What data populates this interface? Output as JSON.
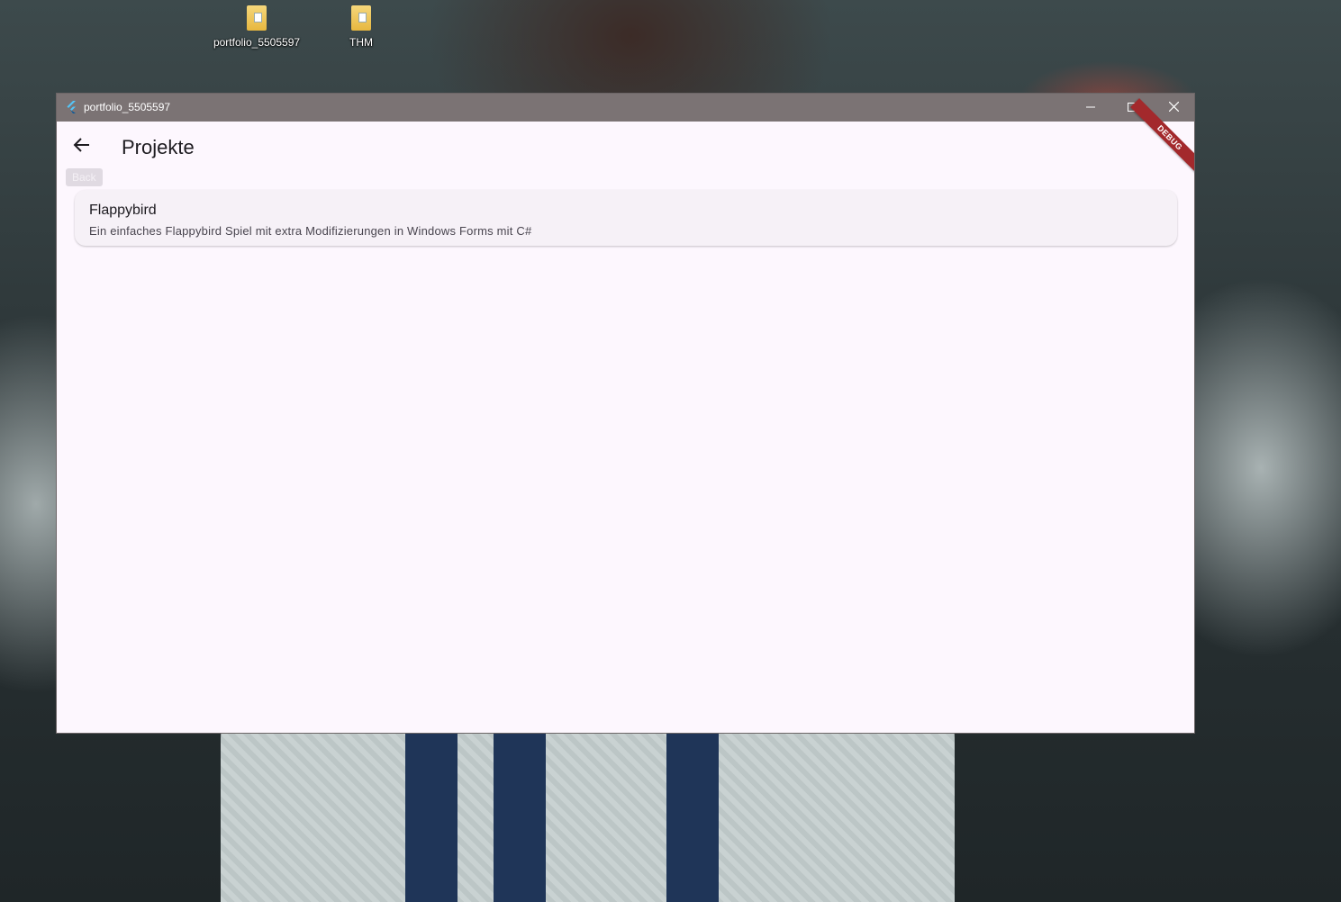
{
  "desktop": {
    "icons": [
      {
        "label": "portfolio_5505597",
        "icon": "folder-icon"
      },
      {
        "label": "THM",
        "icon": "folder-icon"
      }
    ]
  },
  "window": {
    "title": "portfolio_5505597",
    "app_icon": "flutter-icon",
    "controls": [
      "minimize-icon",
      "maximize-icon",
      "close-icon"
    ]
  },
  "appbar": {
    "title": "Projekte",
    "back_icon": "arrow-back-icon",
    "back_tooltip": "Back"
  },
  "projects": [
    {
      "title": "Flappybird",
      "description": "Ein einfaches Flappybird Spiel mit extra Modifizierungen in Windows Forms mit C#"
    }
  ],
  "debug_banner": "DEBUG",
  "colors": {
    "titlebar": "#7b7374",
    "page_background": "#fdf7fe",
    "card_background": "#f6f1f7",
    "debug_banner": "#a3292c"
  }
}
